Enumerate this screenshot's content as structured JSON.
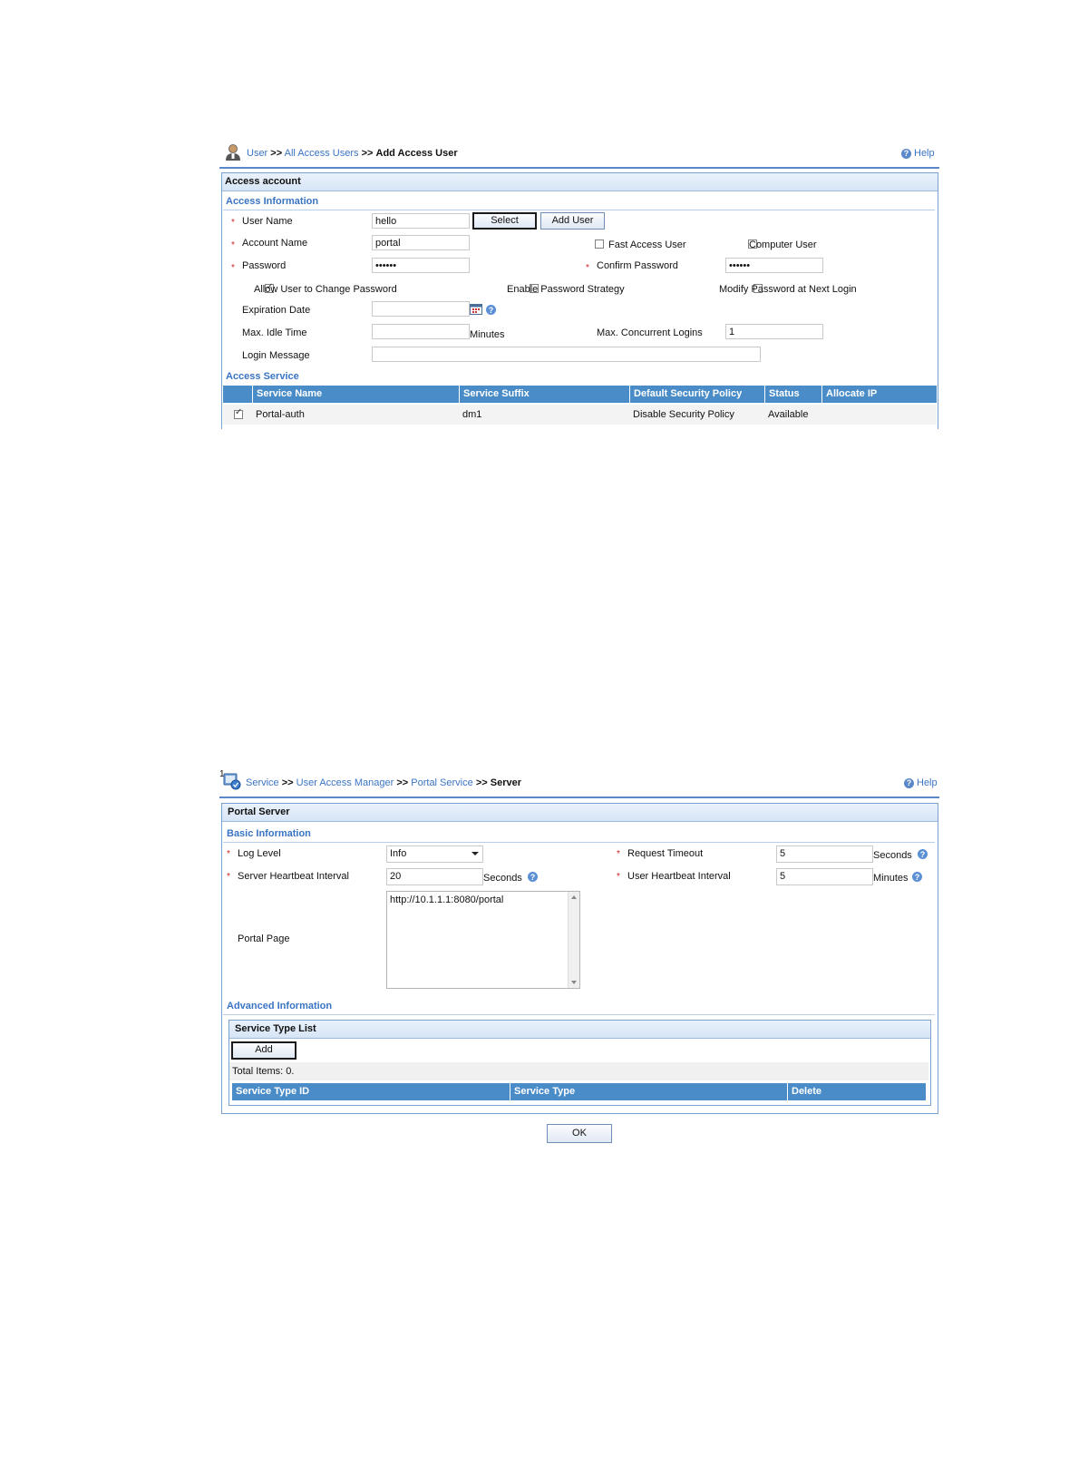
{
  "screen1": {
    "breadcrumb": {
      "item1": "User",
      "sep": ">>",
      "item2": "All Access Users",
      "current": "Add Access User"
    },
    "help": "Help",
    "panel_title": "Access account",
    "section_access_info": "Access Information",
    "fields": {
      "user_name_label": "User Name",
      "user_name_value": "hello",
      "select_button": "Select",
      "add_user_button": "Add User",
      "account_name_label": "Account Name",
      "account_name_value": "portal",
      "fast_access_label": "Fast Access User",
      "computer_user_label": "Computer User",
      "password_label": "Password",
      "password_value": "••••••",
      "confirm_password_label": "Confirm Password",
      "confirm_password_value": "••••••",
      "allow_change_label": "Allow User to Change Password",
      "enable_strategy_label": "Enable Password Strategy",
      "modify_next_label": "Modify Password at Next Login",
      "expiration_label": "Expiration Date",
      "max_idle_label": "Max. Idle Time",
      "minutes_unit": "Minutes",
      "max_concurrent_label": "Max. Concurrent Logins",
      "max_concurrent_value": "1",
      "login_message_label": "Login Message"
    },
    "section_access_service": "Access Service",
    "service_table": {
      "headers": [
        "Service Name",
        "Service Suffix",
        "Default Security Policy",
        "Status",
        "Allocate IP"
      ],
      "rows": [
        {
          "name": "Portal-auth",
          "suffix": "dm1",
          "policy": "Disable Security Policy",
          "status": "Available",
          "allocate_ip": ""
        }
      ]
    }
  },
  "screen2": {
    "marker": "1",
    "breadcrumb": {
      "item1": "Service",
      "sep": ">>",
      "item2": "User Access Manager",
      "item3": "Portal Service",
      "current": "Server"
    },
    "help": "Help",
    "panel_title": "Portal Server",
    "section_basic": "Basic Information",
    "fields": {
      "log_level_label": "Log Level",
      "log_level_value": "Info",
      "request_timeout_label": "Request Timeout",
      "request_timeout_value": "5",
      "seconds_unit": "Seconds",
      "server_heartbeat_label": "Server Heartbeat Interval",
      "server_heartbeat_value": "20",
      "user_heartbeat_label": "User Heartbeat Interval",
      "user_heartbeat_value": "5",
      "minutes_unit": "Minutes",
      "portal_page_label": "Portal Page",
      "portal_page_value": "http://10.1.1.1:8080/portal"
    },
    "section_advanced": "Advanced Information",
    "service_type_list": {
      "title": "Service Type List",
      "add_button": "Add",
      "total": "Total Items: 0.",
      "headers": [
        "Service Type ID",
        "Service Type",
        "Delete"
      ]
    },
    "ok_button": "OK"
  }
}
